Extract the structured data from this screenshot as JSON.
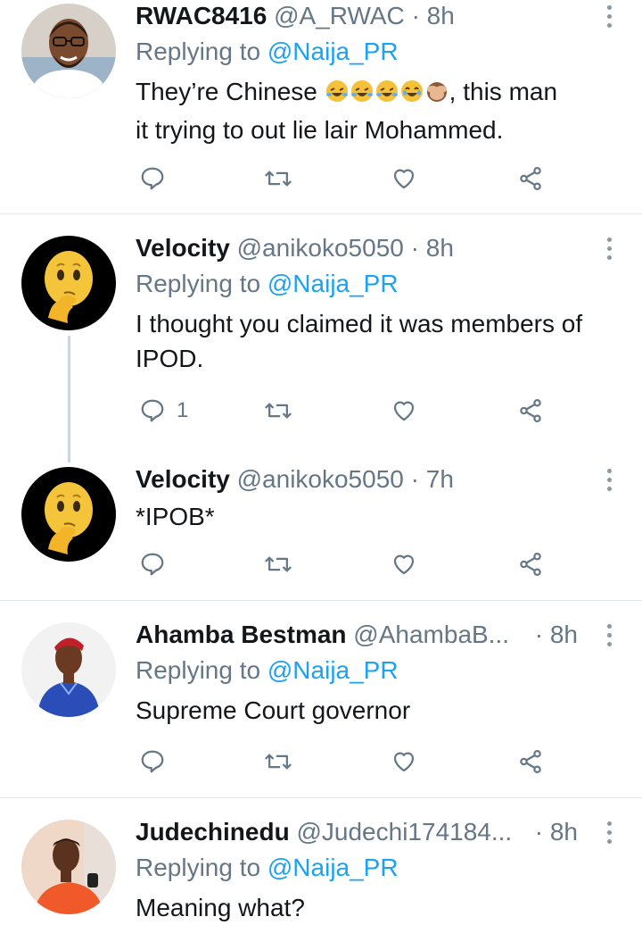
{
  "tweets": [
    {
      "name": "RWAC8416",
      "handle": "@A_RWAC",
      "time": "· 8h",
      "replying_prefix": "Replying to ",
      "replying_to": "@Naija_PR",
      "text_before_emoji": "They’re Chinese ",
      "text_after_emoji": ", this man",
      "text_line2": "it trying to out lie lair Mohammed.",
      "emoji": [
        "rolling-on-floor-laughing",
        "rolling-on-floor-laughing",
        "rolling-on-floor-laughing",
        "face-with-tears-of-joy",
        "see-no-evil-monkey"
      ],
      "reply_count": "",
      "avatar": "avatar-man-glasses"
    },
    {
      "name": "Velocity",
      "handle": "@anikoko5050",
      "time": "· 8h",
      "replying_prefix": "Replying to ",
      "replying_to": "@Naija_PR",
      "text": "I thought you claimed it was members of IPOD.",
      "reply_count": "1",
      "avatar": "avatar-thinking-emoji"
    },
    {
      "name": "Velocity",
      "handle": "@anikoko5050",
      "time": "· 7h",
      "text": "*IPOB*",
      "reply_count": "",
      "avatar": "avatar-thinking-emoji"
    },
    {
      "name": "Ahamba Bestman",
      "handle": "@AhambaB...",
      "time": "· 8h",
      "replying_prefix": "Replying to ",
      "replying_to": "@Naija_PR",
      "text": "Supreme Court governor",
      "reply_count": "",
      "avatar": "avatar-man-blue-outfit"
    },
    {
      "name": "Judechinedu",
      "handle": "@Judechi174184...",
      "time": "· 8h",
      "replying_prefix": "Replying to ",
      "replying_to": "@Naija_PR",
      "text": "Meaning what?",
      "reply_count": "",
      "avatar": "avatar-man-orange-shirt"
    }
  ],
  "colors": {
    "link": "#1da1f2",
    "secondary_text": "#657786",
    "divider": "#e1e8ed",
    "icon": "#657786"
  }
}
